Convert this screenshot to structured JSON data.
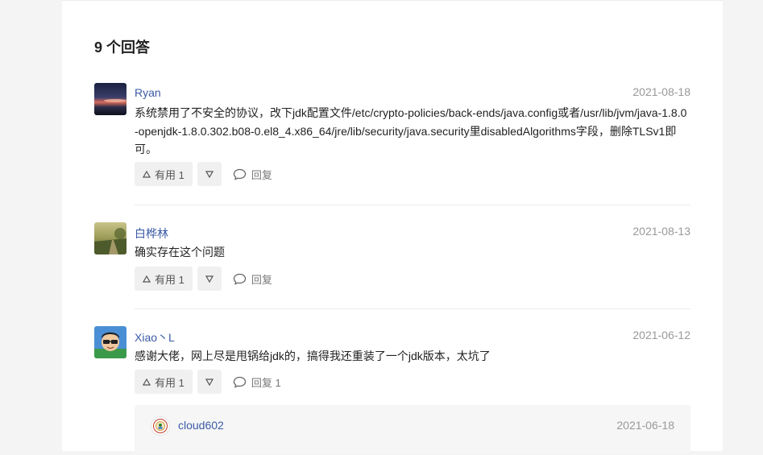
{
  "answers_heading": "9 个回答",
  "answers": [
    {
      "author": "Ryan",
      "date": "2021-08-18",
      "content": "系统禁用了不安全的协议，改下jdk配置文件/etc/crypto-policies/back-ends/java.config或者/usr/lib/jvm/java-1.8.0-openjdk-1.8.0.302.b08-0.el8_4.x86_64/jre/lib/security/java.security里disabledAlgorithms字段，删除TLSv1即可。",
      "upvote_label": "有用 1",
      "reply_label": "回复",
      "avatar_icon": "sunset-photo-avatar"
    },
    {
      "author": "白桦林",
      "date": "2021-08-13",
      "content": "确实存在这个问题",
      "upvote_label": "有用 1",
      "reply_label": "回复",
      "avatar_icon": "landscape-photo-avatar"
    },
    {
      "author": "Xiao丶L",
      "date": "2021-06-12",
      "content": "感谢大佬，网上尽是甩锅给jdk的，搞得我还重装了一个jdk版本，太坑了",
      "upvote_label": "有用 1",
      "reply_label": "回复 1",
      "avatar_icon": "cartoon-avatar",
      "replies": [
        {
          "author": "cloud602",
          "date": "2021-06-18",
          "avatar_icon": "emblem-avatar"
        }
      ]
    }
  ],
  "colors": {
    "link": "#3b5ba5",
    "muted": "#999999",
    "button_bg": "#f0f0f0"
  }
}
